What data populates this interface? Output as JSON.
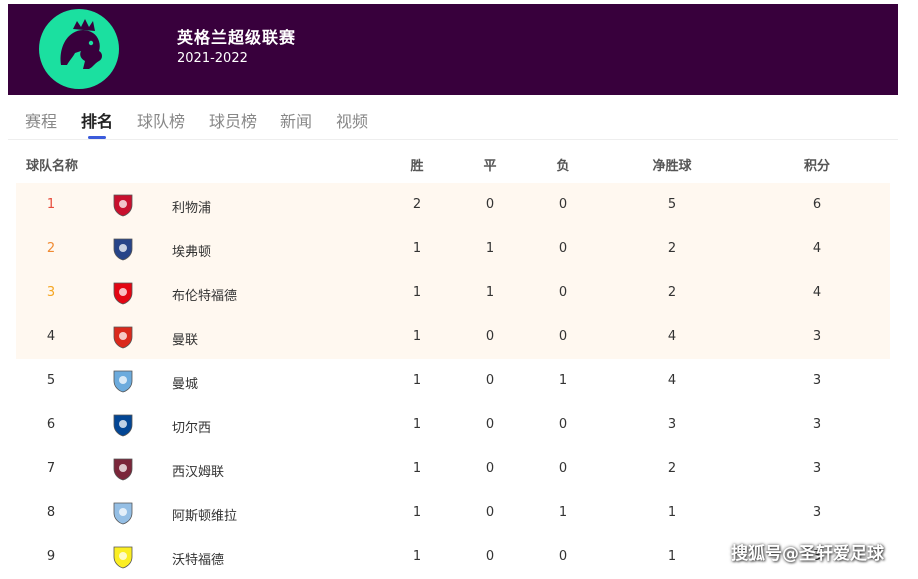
{
  "header": {
    "title": "英格兰超级联赛",
    "season": "2021-2022",
    "logo_color": "#1be0a0",
    "banner_color": "#38003c"
  },
  "tabs": [
    {
      "label": "赛程",
      "active": false
    },
    {
      "label": "排名",
      "active": true
    },
    {
      "label": "球队榜",
      "active": false
    },
    {
      "label": "球员榜",
      "active": false
    },
    {
      "label": "新闻",
      "active": false
    },
    {
      "label": "视频",
      "active": false
    }
  ],
  "table": {
    "headers": {
      "team": "球队名称",
      "won": "胜",
      "drawn": "平",
      "lost": "负",
      "goal_diff": "净胜球",
      "points": "积分"
    },
    "rows": [
      {
        "rank": "1",
        "team": "利物浦",
        "won": "2",
        "drawn": "0",
        "lost": "0",
        "gd": "5",
        "pts": "6",
        "crest": "liverpool-crest-icon",
        "crest_color": "#c8102e",
        "highlight": true
      },
      {
        "rank": "2",
        "team": "埃弗顿",
        "won": "1",
        "drawn": "1",
        "lost": "0",
        "gd": "2",
        "pts": "4",
        "crest": "everton-crest-icon",
        "crest_color": "#274488",
        "highlight": true
      },
      {
        "rank": "3",
        "team": "布伦特福德",
        "won": "1",
        "drawn": "1",
        "lost": "0",
        "gd": "2",
        "pts": "4",
        "crest": "brentford-crest-icon",
        "crest_color": "#e30613",
        "highlight": true
      },
      {
        "rank": "4",
        "team": "曼联",
        "won": "1",
        "drawn": "0",
        "lost": "0",
        "gd": "4",
        "pts": "3",
        "crest": "man-utd-crest-icon",
        "crest_color": "#da291c",
        "highlight": true
      },
      {
        "rank": "5",
        "team": "曼城",
        "won": "1",
        "drawn": "0",
        "lost": "1",
        "gd": "4",
        "pts": "3",
        "crest": "man-city-crest-icon",
        "crest_color": "#6cabdd",
        "highlight": false
      },
      {
        "rank": "6",
        "team": "切尔西",
        "won": "1",
        "drawn": "0",
        "lost": "0",
        "gd": "3",
        "pts": "3",
        "crest": "chelsea-crest-icon",
        "crest_color": "#034694",
        "highlight": false
      },
      {
        "rank": "7",
        "team": "西汉姆联",
        "won": "1",
        "drawn": "0",
        "lost": "0",
        "gd": "2",
        "pts": "3",
        "crest": "west-ham-crest-icon",
        "crest_color": "#7a263a",
        "highlight": false
      },
      {
        "rank": "8",
        "team": "阿斯顿维拉",
        "won": "1",
        "drawn": "0",
        "lost": "1",
        "gd": "1",
        "pts": "3",
        "crest": "aston-villa-crest-icon",
        "crest_color": "#95bfe5",
        "highlight": false
      },
      {
        "rank": "9",
        "team": "沃特福德",
        "won": "1",
        "drawn": "0",
        "lost": "0",
        "gd": "1",
        "pts": "3",
        "crest": "watford-crest-icon",
        "crest_color": "#fbee23",
        "highlight": false
      }
    ]
  },
  "watermark": "搜狐号@圣轩爱足球"
}
